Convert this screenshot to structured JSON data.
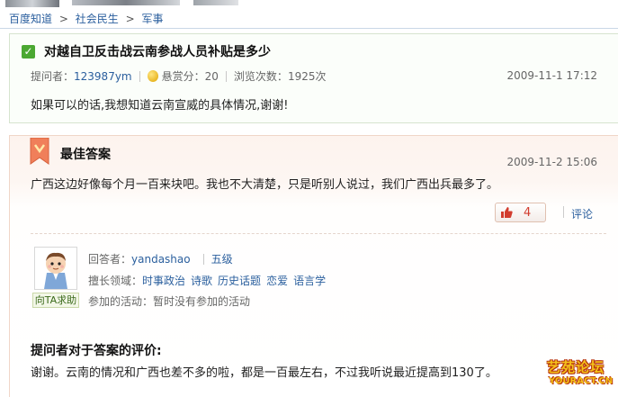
{
  "breadcrumb": {
    "items": [
      "百度知道",
      "社会民生",
      "军事"
    ],
    "separator": ">"
  },
  "question": {
    "title": "对越自卫反击战云南参战人员补贴是多少",
    "asker_label": "提问者：",
    "asker": "123987ym",
    "reward_label": "悬赏分：",
    "reward": "20",
    "views_label": "浏览次数：",
    "views": "1925次",
    "date": "2009-11-1 17:12",
    "body": "如果可以的话,我想知道云南宣威的具体情况,谢谢!"
  },
  "answer": {
    "heading": "最佳答案",
    "date": "2009-11-2 15:06",
    "body": "广西这边好像每个月一百来块吧。我也不大清楚，只是听别人说过，我们广西出兵最多了。",
    "votes": "4",
    "comment_label": "评论",
    "answerer_label": "回答者：",
    "answerer": "yandashao",
    "level": "五级",
    "expertise_label": "擅长领域：",
    "expertise": [
      "时事政治",
      "诗歌",
      "历史话题",
      "恋爱",
      "语言学"
    ],
    "activity_label": "参加的活动：",
    "activity": "暂时没有参加的活动",
    "help_button": "向TA求助"
  },
  "evaluation": {
    "title": "提问者对于答案的评价:",
    "body": "谢谢。云南的情况和广西也差不多的啦，都是一百最左右，不过我听说最近提高到130了。"
  },
  "watermark": {
    "text_cn": "艺苑论坛",
    "text_en": "YOURACT.CN"
  },
  "colors": {
    "link": "#2b5f9e",
    "check_green": "#4ba832",
    "vote_red": "#d23c2e",
    "answer_bg": "#fdf3ee"
  }
}
